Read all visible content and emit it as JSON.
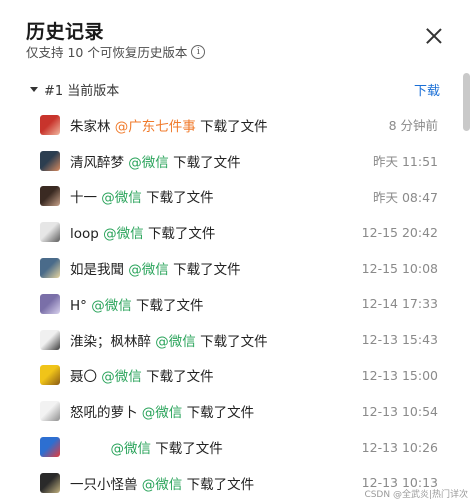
{
  "header": {
    "title": "历史记录",
    "subtitle": "仅支持 10 个可恢复历史版本",
    "info_icon": "info-icon",
    "close_icon": "close-icon"
  },
  "version": {
    "label": "#1 当前版本",
    "download_label": "下载"
  },
  "records": [
    {
      "user": "朱家林",
      "mention": "@广东七件事",
      "mention_color": "#f07b2c",
      "action": "下载了文件",
      "time": "8 分钟前",
      "avatar_colors": [
        "#c8342c",
        "#f2b8a0"
      ]
    },
    {
      "user": "清风醉梦",
      "mention": "@微信",
      "mention_color": "#29a35a",
      "action": "下载了文件",
      "time": "昨天 11:51",
      "avatar_colors": [
        "#2c3e50",
        "#d98b5f"
      ]
    },
    {
      "user": "十一",
      "mention": "@微信",
      "mention_color": "#29a35a",
      "action": "下载了文件",
      "time": "昨天 08:47",
      "avatar_colors": [
        "#3a2a22",
        "#c9a38a"
      ]
    },
    {
      "user": "loop",
      "mention": "@微信",
      "mention_color": "#29a35a",
      "action": "下载了文件",
      "time": "12-15 20:42",
      "avatar_colors": [
        "#e6e6e6",
        "#5a5a5a"
      ]
    },
    {
      "user": "如是我聞",
      "mention": "@微信",
      "mention_color": "#29a35a",
      "action": "下载了文件",
      "time": "12-15 10:08",
      "avatar_colors": [
        "#4a6b8a",
        "#e8d6a0"
      ]
    },
    {
      "user": "H°",
      "mention": "@微信",
      "mention_color": "#29a35a",
      "action": "下载了文件",
      "time": "12-14 17:33",
      "avatar_colors": [
        "#7a6fa8",
        "#d9d2ee"
      ]
    },
    {
      "user": "淮染；枫林醉",
      "mention": "@微信",
      "mention_color": "#29a35a",
      "action": "下载了文件",
      "time": "12-13 15:43",
      "avatar_colors": [
        "#f0f0f0",
        "#3b3b3b"
      ]
    },
    {
      "user": "聂〇",
      "mention": "@微信",
      "mention_color": "#29a35a",
      "action": "下载了文件",
      "time": "12-13 15:00",
      "avatar_colors": [
        "#f0c419",
        "#8a5a14"
      ]
    },
    {
      "user": "怒吼的萝卜",
      "mention": "@微信",
      "mention_color": "#29a35a",
      "action": "下载了文件",
      "time": "12-13 10:54",
      "avatar_colors": [
        "#f2f2f2",
        "#8d8d8d"
      ]
    },
    {
      "user": "",
      "mention": "@微信",
      "mention_color": "#29a35a",
      "action": "下载了文件",
      "time": "12-13 10:26",
      "avatar_colors": [
        "#2d6fd1",
        "#e63b3b"
      ]
    },
    {
      "user": "一只小怪兽",
      "mention": "@微信",
      "mention_color": "#29a35a",
      "action": "下载了文件",
      "time": "12-13 10:13",
      "avatar_colors": [
        "#2a2a2a",
        "#c2b280"
      ]
    }
  ],
  "watermark": "CSDN @全武炎|热门详次"
}
